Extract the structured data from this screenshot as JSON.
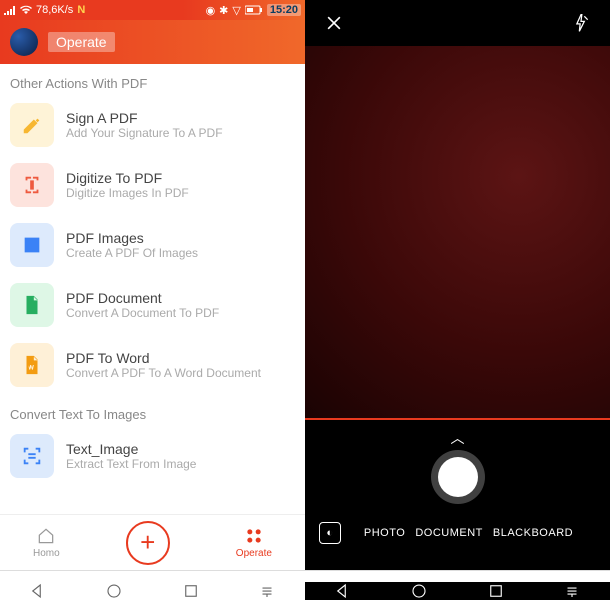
{
  "status": {
    "net_speed": "78,6K/s",
    "net_indicator": "N",
    "time": "15:20"
  },
  "header": {
    "title": "Operate"
  },
  "sections": {
    "other_actions_title": "Other Actions With PDF",
    "convert_text_title": "Convert Text To Images"
  },
  "items": {
    "sign": {
      "title": "Sign A PDF",
      "sub": "Add Your Signature To A PDF"
    },
    "digitize": {
      "title": "Digitize To PDF",
      "sub": "Digitize Images In PDF"
    },
    "pdf_images": {
      "title": "PDF Images",
      "sub": "Create A PDF Of Images"
    },
    "pdf_document": {
      "title": "PDF Document",
      "sub": "Convert A Document To PDF"
    },
    "pdf_word": {
      "title": "PDF To Word",
      "sub": "Convert A PDF To A Word Document"
    },
    "text_image": {
      "title": "Text_Image",
      "sub": "Extract Text From Image"
    }
  },
  "bottom_nav": {
    "home": "Homo",
    "operate": "Operate"
  },
  "camera": {
    "modes": [
      "PHOTO",
      "DOCUMENT",
      "BLACKBOARD"
    ]
  },
  "colors": {
    "accent_gradient_start": "#e83a1f",
    "accent_gradient_end": "#f0682a"
  }
}
